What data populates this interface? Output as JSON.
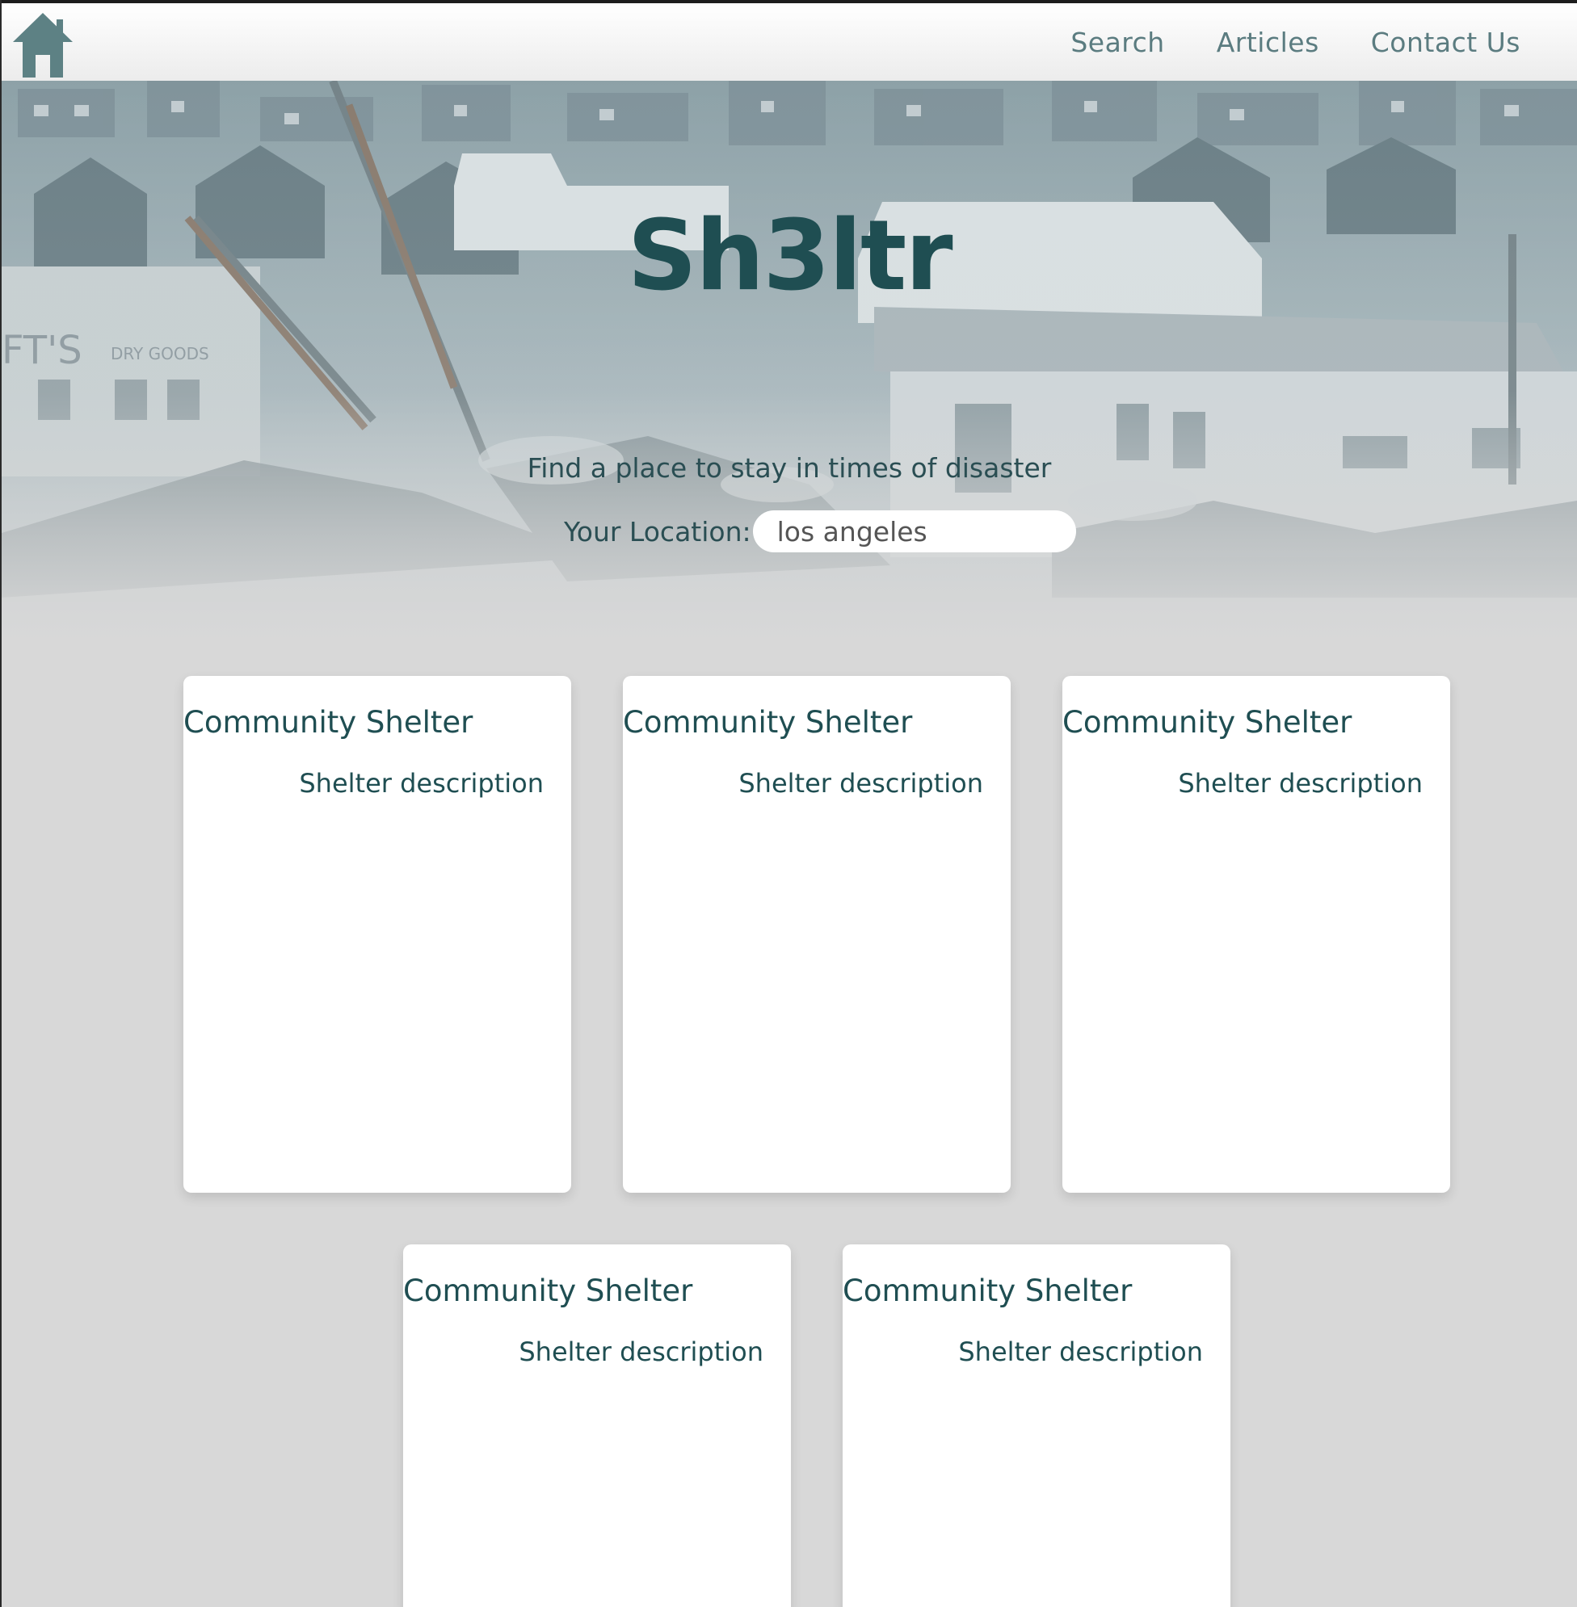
{
  "nav": {
    "home_icon": "home-icon",
    "links": [
      "Search",
      "Articles",
      "Contact Us"
    ]
  },
  "hero": {
    "title": "Sh3ltr",
    "tagline": "Find a place to stay in times of disaster",
    "location_label": "Your Location:",
    "location_value": "los angeles"
  },
  "shelters": [
    {
      "title": "Community Shelter",
      "description": "Shelter description"
    },
    {
      "title": "Community Shelter",
      "description": "Shelter description"
    },
    {
      "title": "Community Shelter",
      "description": "Shelter description"
    },
    {
      "title": "Community Shelter",
      "description": "Shelter description"
    },
    {
      "title": "Community Shelter",
      "description": "Shelter description"
    }
  ],
  "colors": {
    "brand": "#1f4e52",
    "nav_text": "#5b7c80",
    "page_bg": "#d8d8d8",
    "card_bg": "#ffffff"
  }
}
